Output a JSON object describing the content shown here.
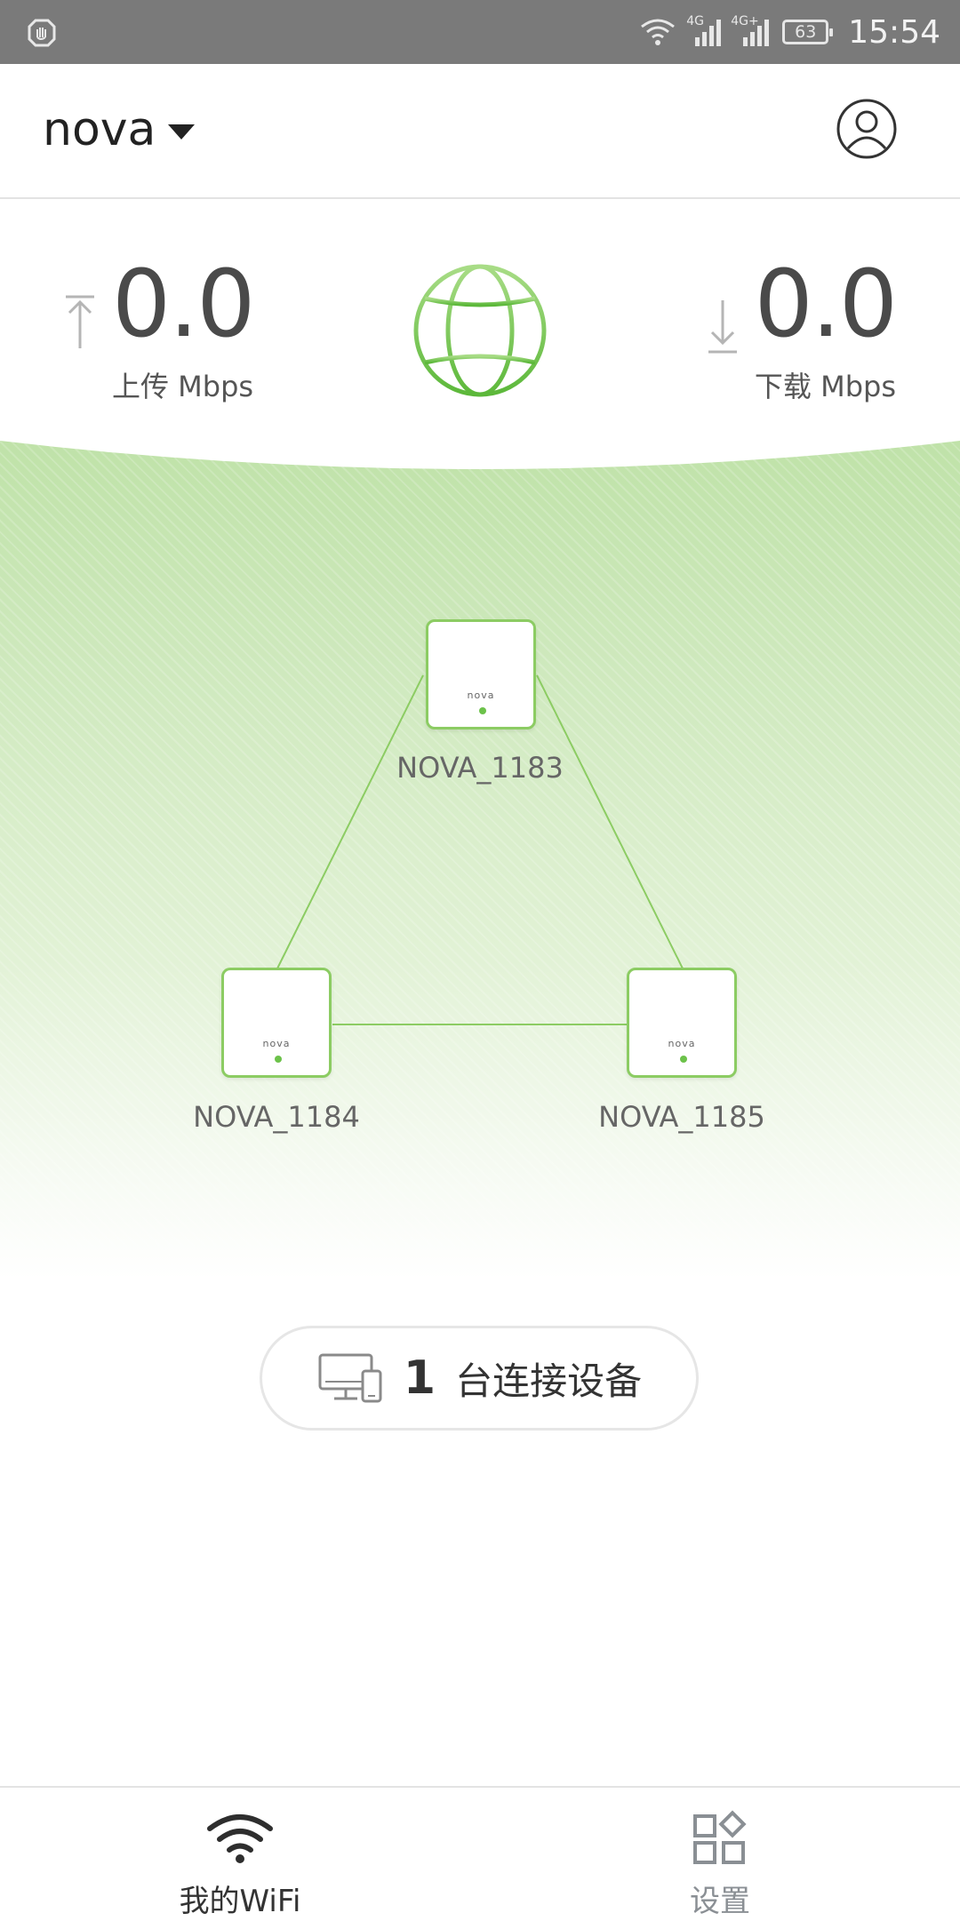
{
  "status_bar": {
    "network_1": "4G",
    "network_2": "4G+",
    "battery": "63",
    "time": "15:54",
    "icons": [
      "notification-icon",
      "wifi-icon",
      "signal-icon",
      "signal-icon",
      "battery-icon"
    ]
  },
  "header": {
    "network_name": "nova",
    "account_icon": "user-icon"
  },
  "speed": {
    "upload_value": "0.0",
    "upload_label": "上传 Mbps",
    "download_value": "0.0",
    "download_label": "下载 Mbps",
    "status_icon": "globe-icon",
    "accent_color": "#76c44f"
  },
  "topology": {
    "nodes": [
      {
        "name": "NOVA_1183",
        "logo": "nova"
      },
      {
        "name": "NOVA_1184",
        "logo": "nova"
      },
      {
        "name": "NOVA_1185",
        "logo": "nova"
      }
    ]
  },
  "devices": {
    "count": "1",
    "label": "台连接设备",
    "icon": "devices-icon"
  },
  "bottom_nav": {
    "items": [
      {
        "label": "我的WiFi",
        "icon": "wifi-icon",
        "active": true
      },
      {
        "label": "设置",
        "icon": "grid-icon",
        "active": false
      }
    ]
  }
}
